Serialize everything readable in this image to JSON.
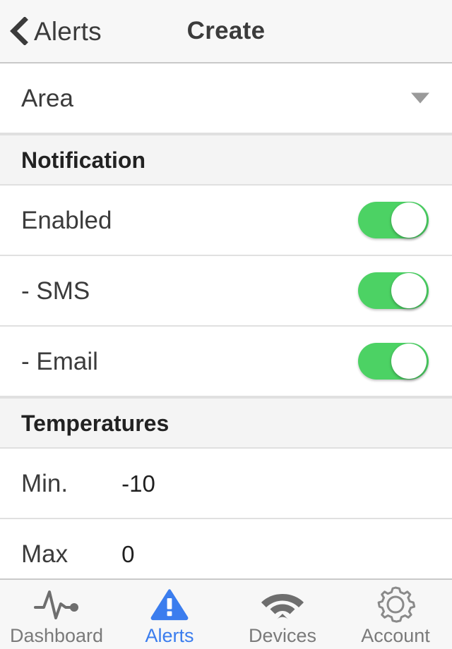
{
  "navbar": {
    "back_label": "Alerts",
    "back_icon": "chevron-left-icon",
    "title": "Create"
  },
  "form": {
    "area": {
      "label": "Area",
      "value": "",
      "control": "dropdown",
      "caret_icon": "chevron-down-icon"
    },
    "sections": [
      {
        "title": "Notification",
        "rows": [
          {
            "label": "Enabled",
            "control": "switch",
            "state": "on"
          },
          {
            "label": "- SMS",
            "control": "switch",
            "state": "on"
          },
          {
            "label": "- Email",
            "control": "switch",
            "state": "on"
          }
        ]
      },
      {
        "title": "Temperatures",
        "rows": [
          {
            "label": "Min.",
            "value": "-10"
          },
          {
            "label": "Max",
            "value": "0"
          }
        ]
      }
    ]
  },
  "colors": {
    "switch_on": "#4CD264",
    "accent": "#3B7DEE",
    "tab_inactive": "#7A7A7A",
    "section_bg": "#F4F4F4",
    "bar_bg": "#F7F7F7"
  },
  "tabbar": {
    "items": [
      {
        "label": "Dashboard",
        "icon": "pulse-icon",
        "active": false
      },
      {
        "label": "Alerts",
        "icon": "warning-triangle-icon",
        "active": true
      },
      {
        "label": "Devices",
        "icon": "wifi-icon",
        "active": false
      },
      {
        "label": "Account",
        "icon": "gear-icon",
        "active": false
      }
    ]
  }
}
